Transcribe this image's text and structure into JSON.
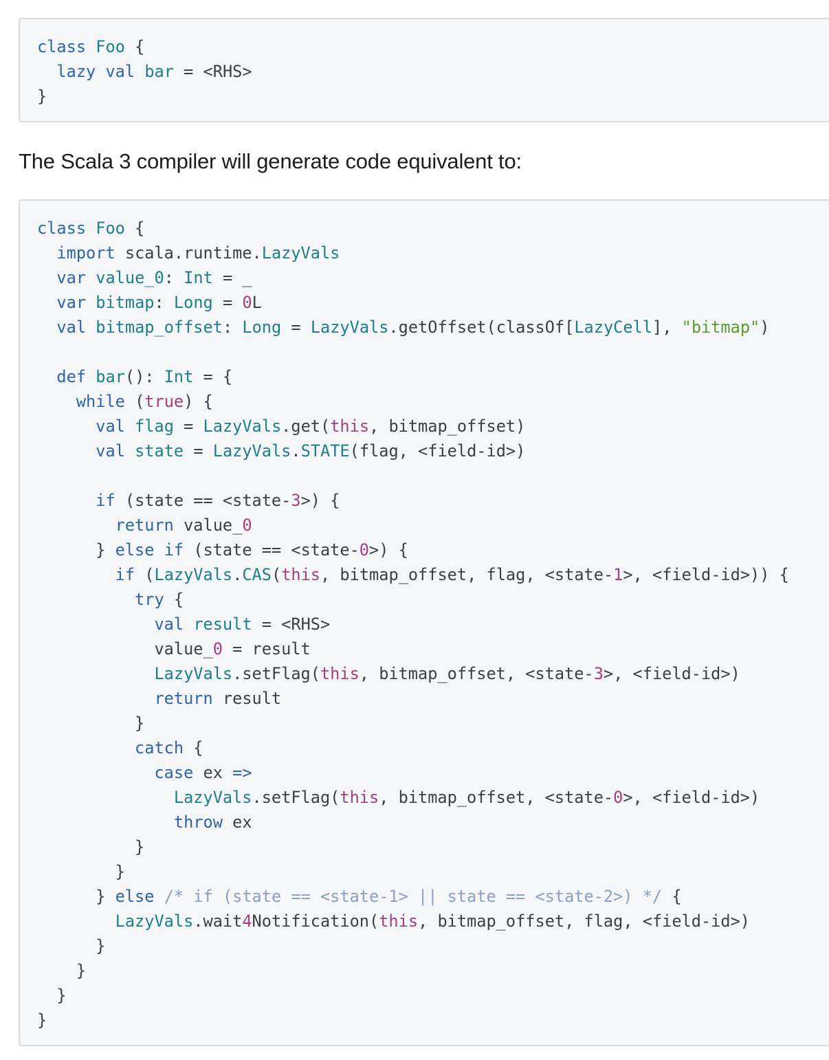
{
  "snippet1": {
    "lines": [
      [
        [
          "kw",
          "class"
        ],
        [
          "pl",
          " "
        ],
        [
          "ty",
          "Foo"
        ],
        [
          "pl",
          " {"
        ]
      ],
      [
        [
          "pl",
          "  "
        ],
        [
          "kw",
          "lazy"
        ],
        [
          "pl",
          " "
        ],
        [
          "kw",
          "val"
        ],
        [
          "pl",
          " "
        ],
        [
          "fn",
          "bar"
        ],
        [
          "pl",
          " = <RHS>"
        ]
      ],
      [
        [
          "pl",
          "}"
        ]
      ]
    ]
  },
  "description": "The Scala 3 compiler will generate code equivalent to:",
  "snippet2": {
    "lines": [
      [
        [
          "kw",
          "class"
        ],
        [
          "pl",
          " "
        ],
        [
          "ty",
          "Foo"
        ],
        [
          "pl",
          " {"
        ]
      ],
      [
        [
          "pl",
          "  "
        ],
        [
          "kw",
          "import"
        ],
        [
          "pl",
          " scala.runtime."
        ],
        [
          "ty",
          "LazyVals"
        ]
      ],
      [
        [
          "pl",
          "  "
        ],
        [
          "kw",
          "var"
        ],
        [
          "pl",
          " "
        ],
        [
          "fn",
          "value_0"
        ],
        [
          "pl",
          ": "
        ],
        [
          "ty",
          "Int"
        ],
        [
          "pl",
          " = _"
        ]
      ],
      [
        [
          "pl",
          "  "
        ],
        [
          "kw",
          "var"
        ],
        [
          "pl",
          " "
        ],
        [
          "fn",
          "bitmap"
        ],
        [
          "pl",
          ": "
        ],
        [
          "ty",
          "Long"
        ],
        [
          "pl",
          " = "
        ],
        [
          "nm",
          "0"
        ],
        [
          "pl",
          "L"
        ]
      ],
      [
        [
          "pl",
          "  "
        ],
        [
          "kw",
          "val"
        ],
        [
          "pl",
          " "
        ],
        [
          "fn",
          "bitmap_offset"
        ],
        [
          "pl",
          ": "
        ],
        [
          "ty",
          "Long"
        ],
        [
          "pl",
          " = "
        ],
        [
          "ty",
          "LazyVals"
        ],
        [
          "pl",
          ".getOffset(classOf["
        ],
        [
          "ty",
          "LazyCell"
        ],
        [
          "pl",
          "], "
        ],
        [
          "st",
          "\"bitmap\""
        ],
        [
          "pl",
          ")"
        ]
      ],
      [],
      [
        [
          "pl",
          "  "
        ],
        [
          "kw",
          "def"
        ],
        [
          "pl",
          " "
        ],
        [
          "fn",
          "bar"
        ],
        [
          "pl",
          "(): "
        ],
        [
          "ty",
          "Int"
        ],
        [
          "pl",
          " = {"
        ]
      ],
      [
        [
          "pl",
          "    "
        ],
        [
          "kw",
          "while"
        ],
        [
          "pl",
          " ("
        ],
        [
          "nm",
          "true"
        ],
        [
          "pl",
          ") {"
        ]
      ],
      [
        [
          "pl",
          "      "
        ],
        [
          "kw",
          "val"
        ],
        [
          "pl",
          " "
        ],
        [
          "fn",
          "flag"
        ],
        [
          "pl",
          " = "
        ],
        [
          "ty",
          "LazyVals"
        ],
        [
          "pl",
          ".get("
        ],
        [
          "nm",
          "this"
        ],
        [
          "pl",
          ", bitmap_offset)"
        ]
      ],
      [
        [
          "pl",
          "      "
        ],
        [
          "kw",
          "val"
        ],
        [
          "pl",
          " "
        ],
        [
          "fn",
          "state"
        ],
        [
          "pl",
          " = "
        ],
        [
          "ty",
          "LazyVals"
        ],
        [
          "pl",
          "."
        ],
        [
          "ty",
          "STATE"
        ],
        [
          "pl",
          "(flag, <field-id>)"
        ]
      ],
      [],
      [
        [
          "pl",
          "      "
        ],
        [
          "kw",
          "if"
        ],
        [
          "pl",
          " (state == <state-"
        ],
        [
          "nm",
          "3"
        ],
        [
          "pl",
          ">) {"
        ]
      ],
      [
        [
          "pl",
          "        "
        ],
        [
          "kw",
          "return"
        ],
        [
          "pl",
          " value_"
        ],
        [
          "nm",
          "0"
        ]
      ],
      [
        [
          "pl",
          "      } "
        ],
        [
          "kw",
          "else"
        ],
        [
          "pl",
          " "
        ],
        [
          "kw",
          "if"
        ],
        [
          "pl",
          " (state == <state-"
        ],
        [
          "nm",
          "0"
        ],
        [
          "pl",
          ">) {"
        ]
      ],
      [
        [
          "pl",
          "        "
        ],
        [
          "kw",
          "if"
        ],
        [
          "pl",
          " ("
        ],
        [
          "ty",
          "LazyVals"
        ],
        [
          "pl",
          "."
        ],
        [
          "ty",
          "CAS"
        ],
        [
          "pl",
          "("
        ],
        [
          "nm",
          "this"
        ],
        [
          "pl",
          ", bitmap_offset, flag, <state-"
        ],
        [
          "nm",
          "1"
        ],
        [
          "pl",
          ">, <field-id>)) {"
        ]
      ],
      [
        [
          "pl",
          "          "
        ],
        [
          "kw",
          "try"
        ],
        [
          "pl",
          " {"
        ]
      ],
      [
        [
          "pl",
          "            "
        ],
        [
          "kw",
          "val"
        ],
        [
          "pl",
          " "
        ],
        [
          "fn",
          "result"
        ],
        [
          "pl",
          " = <RHS>"
        ]
      ],
      [
        [
          "pl",
          "            value_"
        ],
        [
          "nm",
          "0"
        ],
        [
          "pl",
          " = result"
        ]
      ],
      [
        [
          "pl",
          "            "
        ],
        [
          "ty",
          "LazyVals"
        ],
        [
          "pl",
          ".setFlag("
        ],
        [
          "nm",
          "this"
        ],
        [
          "pl",
          ", bitmap_offset, <state-"
        ],
        [
          "nm",
          "3"
        ],
        [
          "pl",
          ">, <field-id>)"
        ]
      ],
      [
        [
          "pl",
          "            "
        ],
        [
          "kw",
          "return"
        ],
        [
          "pl",
          " result"
        ]
      ],
      [
        [
          "pl",
          "          }"
        ]
      ],
      [
        [
          "pl",
          "          "
        ],
        [
          "kw",
          "catch"
        ],
        [
          "pl",
          " {"
        ]
      ],
      [
        [
          "pl",
          "            "
        ],
        [
          "kw",
          "case"
        ],
        [
          "pl",
          " ex "
        ],
        [
          "kw",
          "=>"
        ]
      ],
      [
        [
          "pl",
          "              "
        ],
        [
          "ty",
          "LazyVals"
        ],
        [
          "pl",
          ".setFlag("
        ],
        [
          "nm",
          "this"
        ],
        [
          "pl",
          ", bitmap_offset, <state-"
        ],
        [
          "nm",
          "0"
        ],
        [
          "pl",
          ">, <field-id>)"
        ]
      ],
      [
        [
          "pl",
          "              "
        ],
        [
          "kw",
          "throw"
        ],
        [
          "pl",
          " ex"
        ]
      ],
      [
        [
          "pl",
          "          }"
        ]
      ],
      [
        [
          "pl",
          "        }"
        ]
      ],
      [
        [
          "pl",
          "      } "
        ],
        [
          "kw",
          "else"
        ],
        [
          "pl",
          " "
        ],
        [
          "cm",
          "/* if (state == <state-1> || state == <state-2>) */"
        ],
        [
          "pl",
          " {"
        ]
      ],
      [
        [
          "pl",
          "        "
        ],
        [
          "ty",
          "LazyVals"
        ],
        [
          "pl",
          ".wait"
        ],
        [
          "nm",
          "4"
        ],
        [
          "pl",
          "Notification("
        ],
        [
          "nm",
          "this"
        ],
        [
          "pl",
          ", bitmap_offset, flag, <field-id>)"
        ]
      ],
      [
        [
          "pl",
          "      }"
        ]
      ],
      [
        [
          "pl",
          "    }"
        ]
      ],
      [
        [
          "pl",
          "  }"
        ]
      ],
      [
        [
          "pl",
          "}"
        ]
      ]
    ]
  }
}
